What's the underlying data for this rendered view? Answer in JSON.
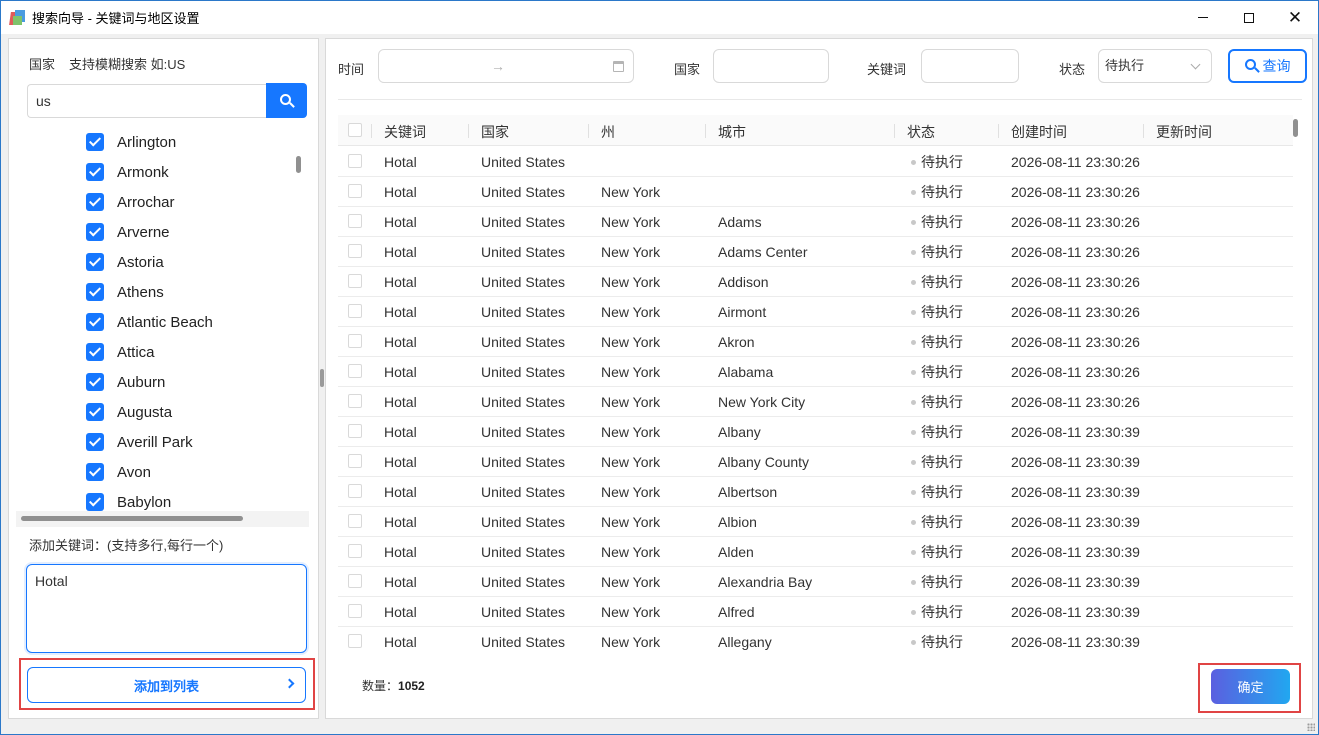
{
  "window": {
    "title": "搜索向导 - 关键词与地区设置",
    "accent": "#1677ff"
  },
  "left": {
    "country_label": "国家",
    "country_hint": "支持模糊搜索  如:US",
    "search_value": "us",
    "tree_items": [
      {
        "label": "Arlington",
        "checked": true
      },
      {
        "label": "Armonk",
        "checked": true
      },
      {
        "label": "Arrochar",
        "checked": true
      },
      {
        "label": "Arverne",
        "checked": true
      },
      {
        "label": "Astoria",
        "checked": true
      },
      {
        "label": "Athens",
        "checked": true
      },
      {
        "label": "Atlantic Beach",
        "checked": true
      },
      {
        "label": "Attica",
        "checked": true
      },
      {
        "label": "Auburn",
        "checked": true
      },
      {
        "label": "Augusta",
        "checked": true
      },
      {
        "label": "Averill Park",
        "checked": true
      },
      {
        "label": "Avon",
        "checked": true
      },
      {
        "label": "Babylon",
        "checked": true
      }
    ],
    "keyword_label": "添加关键词：(支持多行,每行一个)",
    "keyword_value": "Hotal",
    "add_button": "添加到列表"
  },
  "filters": {
    "time_label": "时间",
    "date_separator": "→",
    "country_label": "国家",
    "keyword_label": "关键词",
    "status_label": "状态",
    "status_value": "待执行",
    "query_button": "查询"
  },
  "table": {
    "headers": [
      "关键词",
      "国家",
      "州",
      "城市",
      "状态",
      "创建时间",
      "更新时间"
    ],
    "rows": [
      [
        "Hotal",
        "United States",
        "",
        "",
        "待执行",
        "2026-08-11 23:30:26",
        ""
      ],
      [
        "Hotal",
        "United States",
        "New York",
        "",
        "待执行",
        "2026-08-11 23:30:26",
        ""
      ],
      [
        "Hotal",
        "United States",
        "New York",
        "Adams",
        "待执行",
        "2026-08-11 23:30:26",
        ""
      ],
      [
        "Hotal",
        "United States",
        "New York",
        "Adams Center",
        "待执行",
        "2026-08-11 23:30:26",
        ""
      ],
      [
        "Hotal",
        "United States",
        "New York",
        "Addison",
        "待执行",
        "2026-08-11 23:30:26",
        ""
      ],
      [
        "Hotal",
        "United States",
        "New York",
        "Airmont",
        "待执行",
        "2026-08-11 23:30:26",
        ""
      ],
      [
        "Hotal",
        "United States",
        "New York",
        "Akron",
        "待执行",
        "2026-08-11 23:30:26",
        ""
      ],
      [
        "Hotal",
        "United States",
        "New York",
        "Alabama",
        "待执行",
        "2026-08-11 23:30:26",
        ""
      ],
      [
        "Hotal",
        "United States",
        "New York",
        "New York City",
        "待执行",
        "2026-08-11 23:30:26",
        ""
      ],
      [
        "Hotal",
        "United States",
        "New York",
        "Albany",
        "待执行",
        "2026-08-11 23:30:39",
        ""
      ],
      [
        "Hotal",
        "United States",
        "New York",
        "Albany County",
        "待执行",
        "2026-08-11 23:30:39",
        ""
      ],
      [
        "Hotal",
        "United States",
        "New York",
        "Albertson",
        "待执行",
        "2026-08-11 23:30:39",
        ""
      ],
      [
        "Hotal",
        "United States",
        "New York",
        "Albion",
        "待执行",
        "2026-08-11 23:30:39",
        ""
      ],
      [
        "Hotal",
        "United States",
        "New York",
        "Alden",
        "待执行",
        "2026-08-11 23:30:39",
        ""
      ],
      [
        "Hotal",
        "United States",
        "New York",
        "Alexandria Bay",
        "待执行",
        "2026-08-11 23:30:39",
        ""
      ],
      [
        "Hotal",
        "United States",
        "New York",
        "Alfred",
        "待执行",
        "2026-08-11 23:30:39",
        ""
      ],
      [
        "Hotal",
        "United States",
        "New York",
        "Allegany",
        "待执行",
        "2026-08-11 23:30:39",
        ""
      ]
    ]
  },
  "footer": {
    "count_label": "数量：",
    "count_value": "1052",
    "confirm_button": "确定"
  }
}
